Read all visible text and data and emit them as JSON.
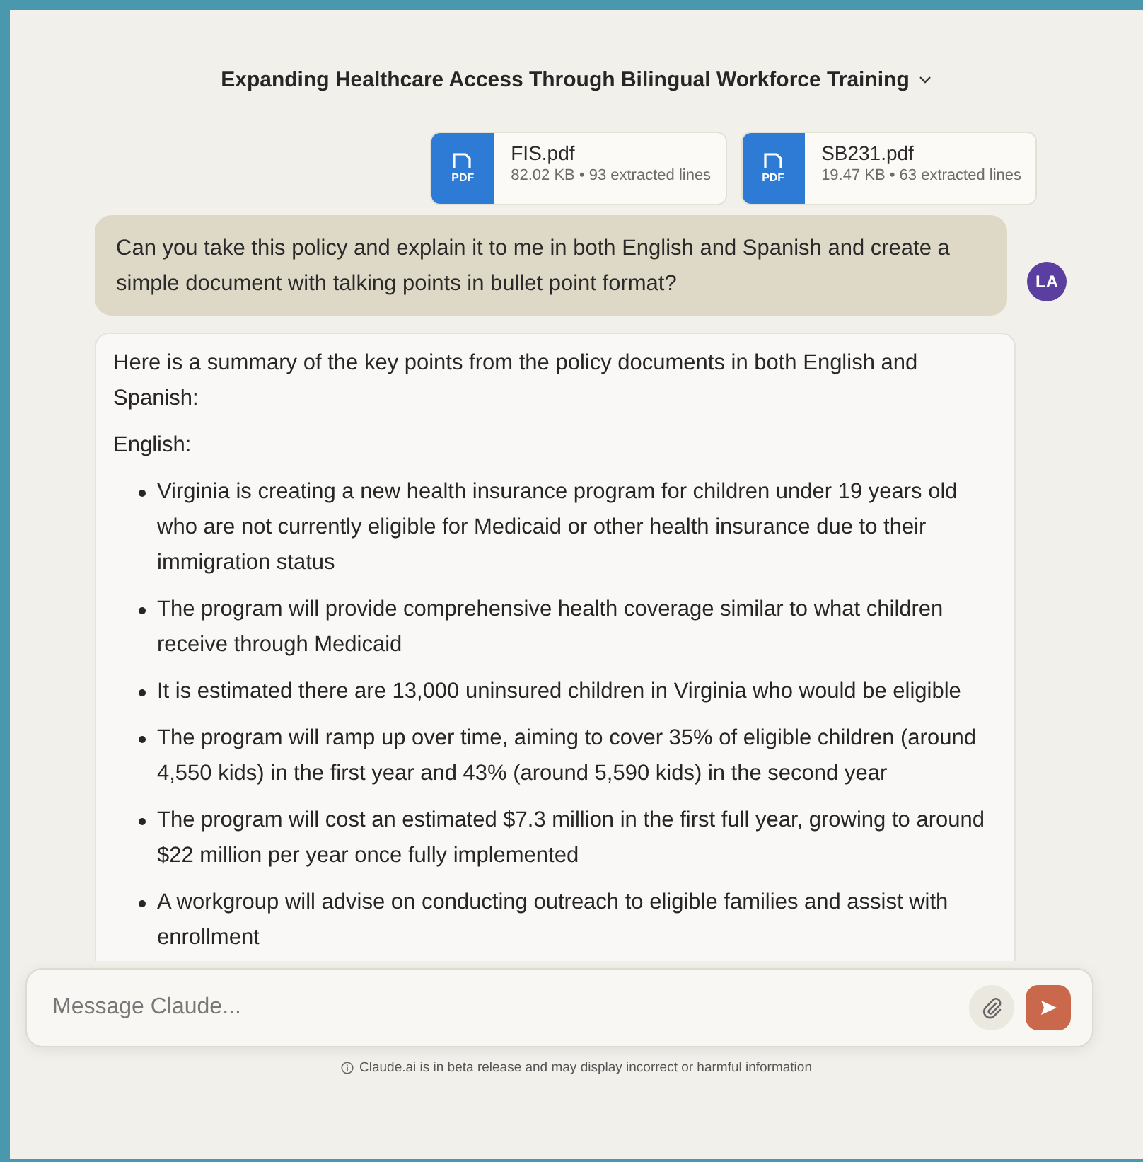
{
  "title": "Expanding Healthcare Access Through Bilingual Workforce Training",
  "attachments": [
    {
      "name": "FIS.pdf",
      "meta": "82.02 KB • 93 extracted lines",
      "badge": "PDF"
    },
    {
      "name": "SB231.pdf",
      "meta": "19.47 KB • 63 extracted lines",
      "badge": "PDF"
    }
  ],
  "user_message": {
    "text": "Can you take this policy and explain it to me in both English and Spanish and create a simple document with talking points in bullet point format?",
    "avatar": "LA"
  },
  "assistant_message": {
    "intro": "Here is a summary of the key points from the policy documents in both English and Spanish:",
    "section": "English:",
    "bullets": [
      "Virginia is creating a new health insurance program for children under 19 years old who are not currently eligible for Medicaid or other health insurance due to their immigration status",
      "The program will provide comprehensive health coverage similar to what children receive through Medicaid",
      "It is estimated there are 13,000 uninsured children in Virginia who would be eligible",
      "The program will ramp up over time, aiming to cover 35% of eligible children (around 4,550 kids) in the first year and 43% (around 5,590 kids) in the second year",
      "The program will cost an estimated $7.3 million in the first full year, growing to around $22 million per year once fully implemented",
      "A workgroup will advise on conducting outreach to eligible families and assist with enrollment"
    ]
  },
  "composer": {
    "placeholder": "Message Claude..."
  },
  "disclaimer": "Claude.ai is in beta release and may display incorrect or harmful information"
}
